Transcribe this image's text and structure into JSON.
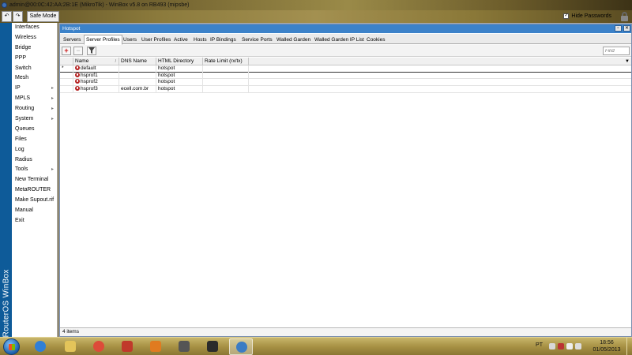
{
  "window": {
    "title": "admin@00:0C:42:AA:2B:1E (MikroTik) - WinBox v5.8 on RB493 (mipsbe)"
  },
  "toolbar": {
    "undo_label": "↶",
    "redo_label": "↷",
    "safe_mode_label": "Safe Mode",
    "hide_passwords_label": "Hide Passwords",
    "hide_passwords_checked": "✓"
  },
  "brand": {
    "vertical_text": "RouterOS WinBox"
  },
  "menu": {
    "items": [
      {
        "label": "Interfaces",
        "arrow": ""
      },
      {
        "label": "Wireless",
        "arrow": ""
      },
      {
        "label": "Bridge",
        "arrow": ""
      },
      {
        "label": "PPP",
        "arrow": ""
      },
      {
        "label": "Switch",
        "arrow": ""
      },
      {
        "label": "Mesh",
        "arrow": ""
      },
      {
        "label": "IP",
        "arrow": "▸"
      },
      {
        "label": "MPLS",
        "arrow": "▸"
      },
      {
        "label": "Routing",
        "arrow": "▸"
      },
      {
        "label": "System",
        "arrow": "▸"
      },
      {
        "label": "Queues",
        "arrow": ""
      },
      {
        "label": "Files",
        "arrow": ""
      },
      {
        "label": "Log",
        "arrow": ""
      },
      {
        "label": "Radius",
        "arrow": ""
      },
      {
        "label": "Tools",
        "arrow": "▸"
      },
      {
        "label": "New Terminal",
        "arrow": ""
      },
      {
        "label": "MetaROUTER",
        "arrow": ""
      },
      {
        "label": "Make Supout.rif",
        "arrow": ""
      },
      {
        "label": "Manual",
        "arrow": ""
      },
      {
        "label": "Exit",
        "arrow": ""
      }
    ]
  },
  "hotspot": {
    "title": "Hotspot",
    "tabs": [
      {
        "label": "Servers"
      },
      {
        "label": "Server Profiles"
      },
      {
        "label": "Users"
      },
      {
        "label": "User Profiles"
      },
      {
        "label": "Active"
      },
      {
        "label": "Hosts"
      },
      {
        "label": "IP Bindings"
      },
      {
        "label": "Service Ports"
      },
      {
        "label": "Walled Garden"
      },
      {
        "label": "Walled Garden IP List"
      },
      {
        "label": "Cookies"
      }
    ],
    "active_tab": "Server Profiles",
    "find_placeholder": "Find",
    "columns": [
      "",
      "Name",
      "DNS Name",
      "HTML Directory",
      "Rate Limit (rx/tx)"
    ],
    "sort_indicator": "/",
    "column_menu_icon": "▼",
    "rows": [
      {
        "flag": "*",
        "name": "default",
        "dns": "",
        "html_dir": "hotspot",
        "rate": ""
      },
      {
        "flag": "",
        "name": "hsprof1",
        "dns": "",
        "html_dir": "hotspot",
        "rate": ""
      },
      {
        "flag": "",
        "name": "hsprof2",
        "dns": "",
        "html_dir": "hotspot",
        "rate": ""
      },
      {
        "flag": "",
        "name": "hsprof3",
        "dns": "ecell.com.br",
        "html_dir": "hotspot",
        "rate": ""
      }
    ],
    "status": "4 items"
  },
  "taskbar": {
    "language": "PT",
    "time": "18:56",
    "date": "01/05/2013",
    "apps": [
      "internet-explorer",
      "file-explorer",
      "chrome",
      "app-red",
      "media-player",
      "app-figure",
      "app-dark",
      "winbox"
    ]
  },
  "colors": {
    "accent_blue": "#3c82c9",
    "brand_strip": "#0e5b99",
    "add_red": "#c81414"
  }
}
